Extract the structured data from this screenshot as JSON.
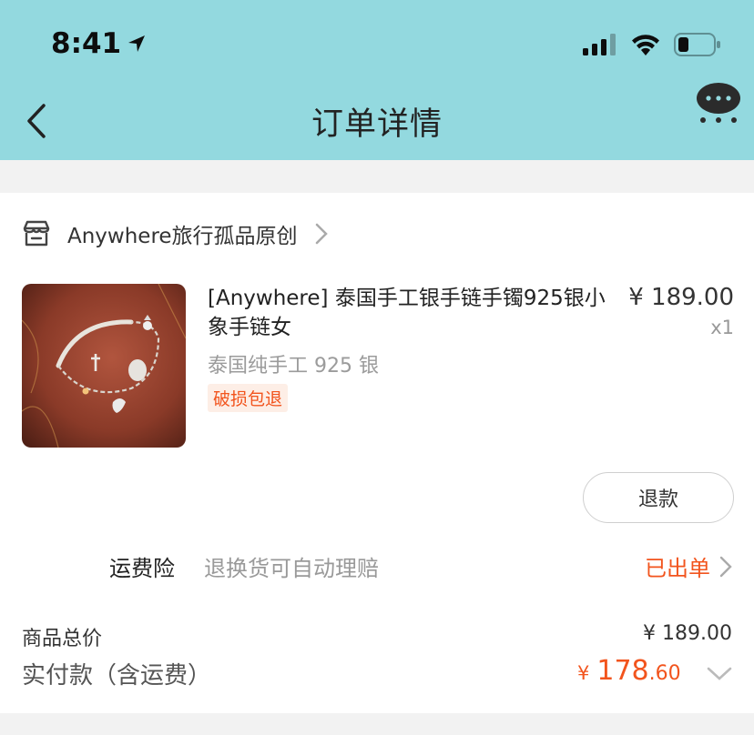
{
  "status_bar": {
    "time": "8:41"
  },
  "nav": {
    "title": "订单详情"
  },
  "store": {
    "name": "Anywhere旅行孤品原创"
  },
  "product": {
    "name": "[Anywhere] 泰国手工银手链手镯925银小象手链女",
    "spec": "泰国纯手工 925 银",
    "tag": "破损包退",
    "price": "¥ 189.00",
    "quantity": "x1"
  },
  "actions": {
    "refund_label": "退款"
  },
  "shipping_insurance": {
    "label": "运费险",
    "description": "退换货可自动理赔",
    "status": "已出单"
  },
  "summary": {
    "goods_total_label": "商品总价",
    "goods_total_value": "¥ 189.00",
    "paid_label": "实付款（含运费）",
    "paid_currency": "¥",
    "paid_integer": "178",
    "paid_decimal": ".60"
  },
  "colors": {
    "header_bg": "#93d9df",
    "accent": "#f2541d"
  }
}
